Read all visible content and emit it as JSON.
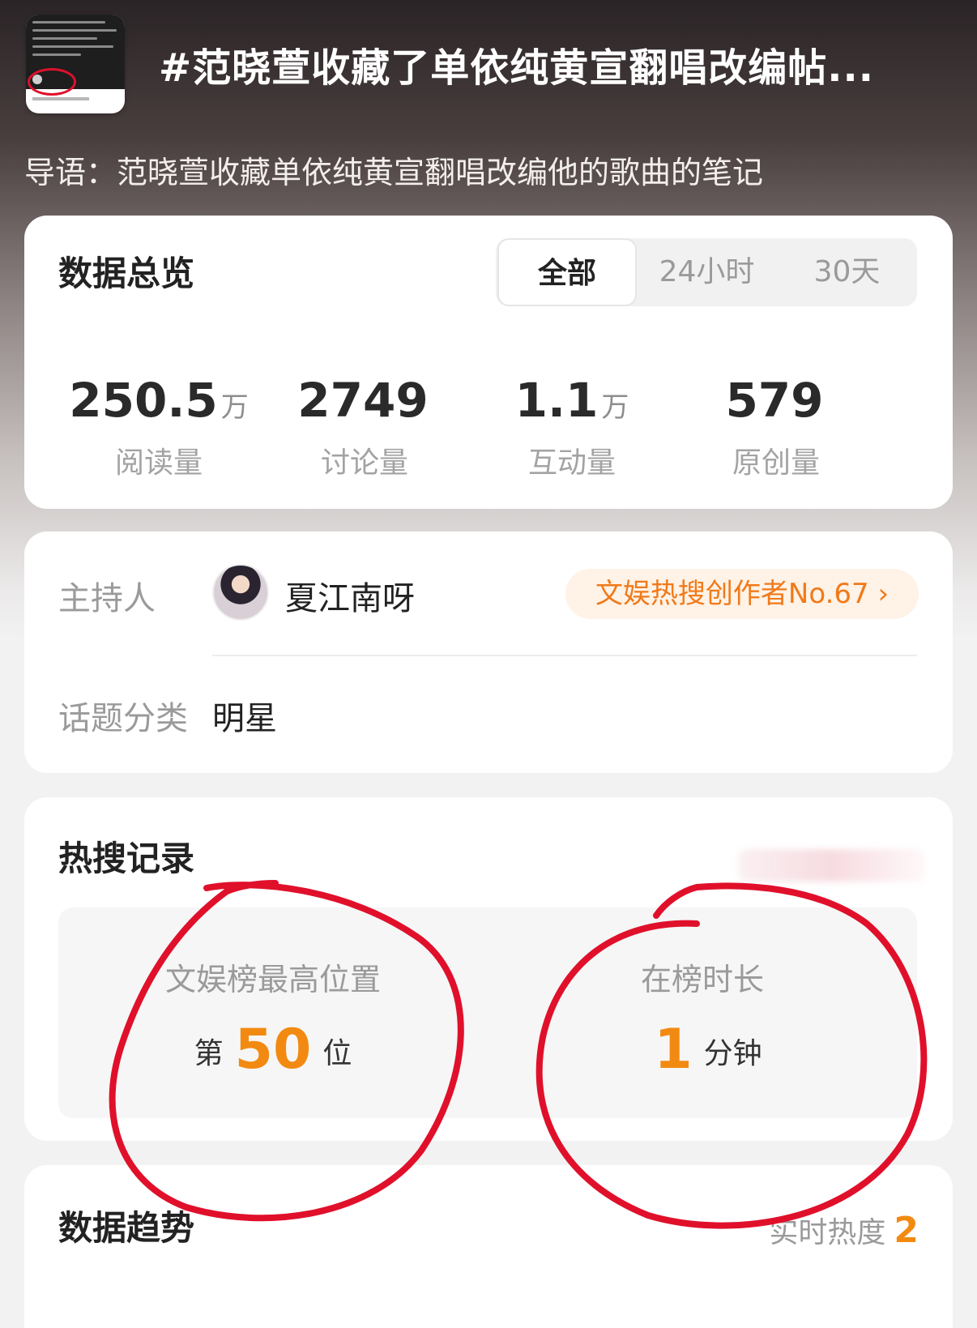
{
  "header": {
    "title": "#范晓萱收藏了单依纯黄宣翻唱改编帖...",
    "guide": "导语：范晓萱收藏单依纯黄宣翻唱改编他的歌曲的笔记"
  },
  "overview": {
    "title": "数据总览",
    "tabs": [
      "全部",
      "24小时",
      "30天"
    ],
    "active_tab": "全部",
    "stats": [
      {
        "value": "250.5",
        "unit": "万",
        "label": "阅读量"
      },
      {
        "value": "2749",
        "unit": "",
        "label": "讨论量"
      },
      {
        "value": "1.1",
        "unit": "万",
        "label": "互动量"
      },
      {
        "value": "579",
        "unit": "",
        "label": "原创量"
      }
    ]
  },
  "host": {
    "label": "主持人",
    "name": "夏江南呀",
    "badge": "文娱热搜创作者No.67 ›",
    "category_label": "话题分类",
    "category": "明星"
  },
  "hot_search": {
    "title": "热搜记录",
    "rank_label": "文娱榜最高位置",
    "rank_prefix": "第",
    "rank_value": "50",
    "rank_suffix": "位",
    "duration_label": "在榜时长",
    "duration_value": "1",
    "duration_unit": "分钟"
  },
  "trend": {
    "title": "数据趋势",
    "live_heat_label": "实时热度",
    "live_heat_value": "2"
  },
  "colors": {
    "accent_orange": "#f28a12",
    "annotation_red": "#e0102b"
  }
}
